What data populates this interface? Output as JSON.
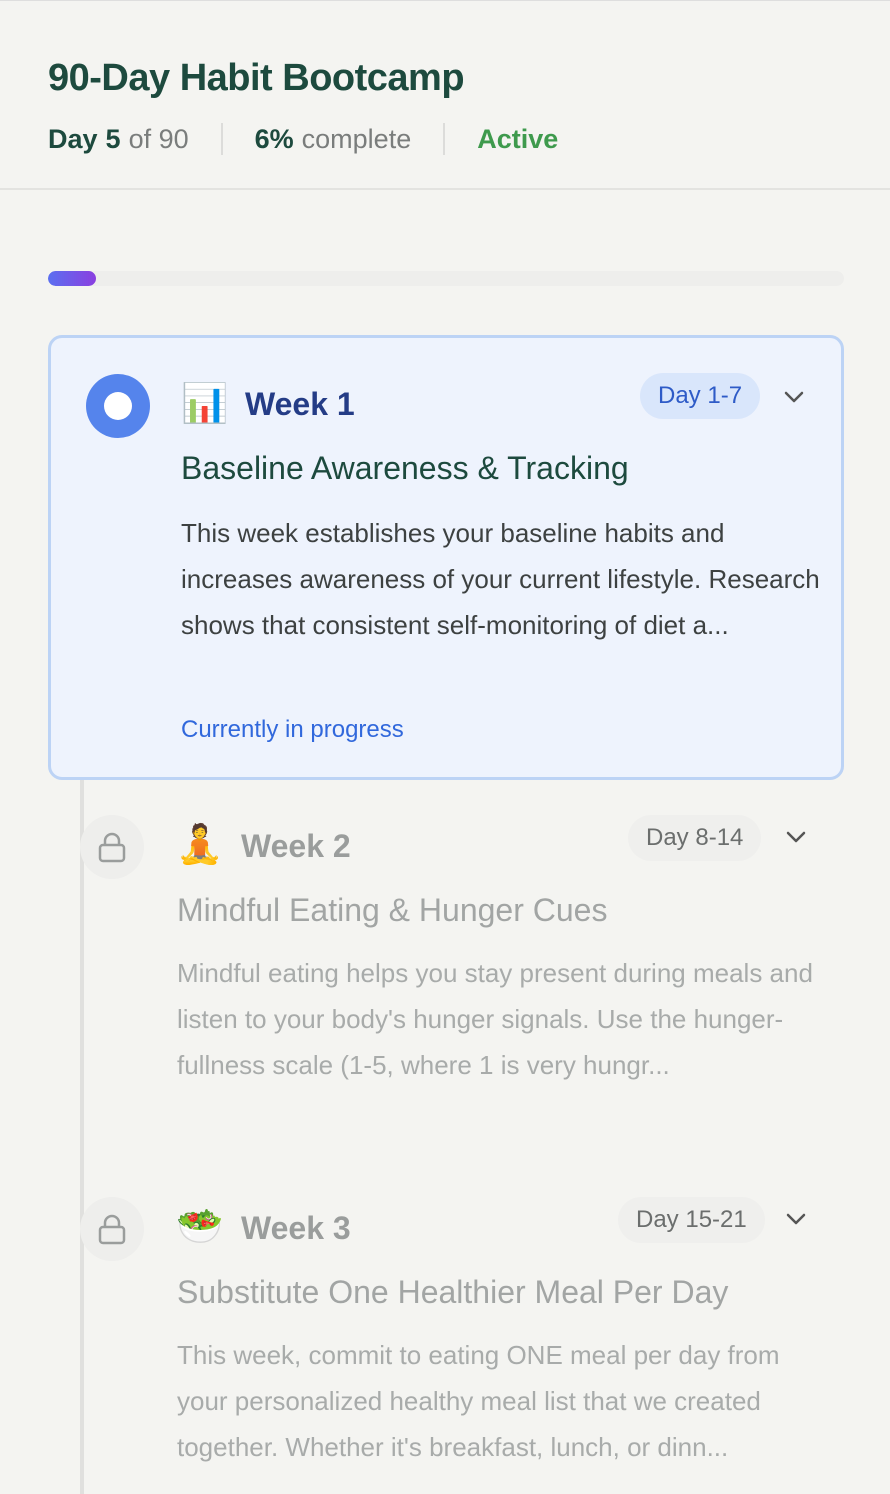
{
  "header": {
    "title": "90-Day Habit Bootcamp",
    "day_prefix": "Day",
    "day_current": "5",
    "day_total_text": "of 90",
    "percent": "6%",
    "percent_suffix": "complete",
    "status": "Active"
  },
  "progress": {
    "fraction": 0.06,
    "gradient_start": "#5b6ff0",
    "gradient_end": "#8a3fe0"
  },
  "weeks": [
    {
      "week_label": "Week 1",
      "emoji": "📊",
      "emoji_name": "bar-chart-icon",
      "day_range": "Day 1-7",
      "title": "Baseline Awareness & Tracking",
      "description": "This week establishes your baseline habits and increases awareness of your current lifestyle. Research shows that consistent self-monitoring of diet a...",
      "status_text": "Currently in progress",
      "state": "active"
    },
    {
      "week_label": "Week 2",
      "emoji": "🧘",
      "emoji_name": "meditation-icon",
      "day_range": "Day 8-14",
      "title": "Mindful Eating & Hunger Cues",
      "description": "Mindful eating helps you stay present during meals and listen to your body's hunger signals. Use the hunger-fullness scale (1-5, where 1 is very hungr...",
      "state": "locked"
    },
    {
      "week_label": "Week 3",
      "emoji": "🥗",
      "emoji_name": "salad-icon",
      "day_range": "Day 15-21",
      "title": "Substitute One Healthier Meal Per Day",
      "description": "This week, commit to eating ONE meal per day from your personalized healthy meal list that we created together. Whether it's breakfast, lunch, or dinn...",
      "state": "locked"
    }
  ],
  "colors": {
    "accent_blue": "#5584ec",
    "active_green": "#3e9a4d",
    "title_green": "#1d4a3e"
  }
}
